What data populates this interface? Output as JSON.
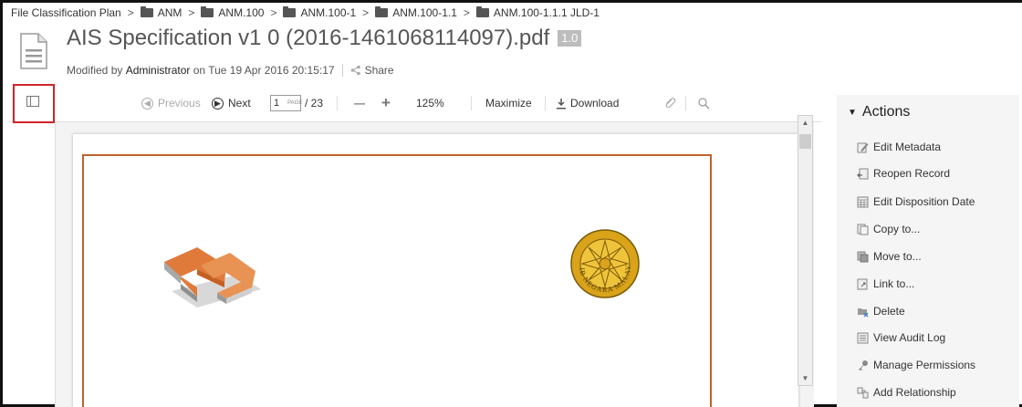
{
  "breadcrumb": [
    {
      "label": "File Classification Plan",
      "folder": false
    },
    {
      "label": "ANM",
      "folder": true
    },
    {
      "label": "ANM.100",
      "folder": true
    },
    {
      "label": "ANM.100-1",
      "folder": true
    },
    {
      "label": "ANM.100-1.1",
      "folder": true
    },
    {
      "label": "ANM.100-1.1.1 JLD-1",
      "folder": true
    }
  ],
  "breadcrumb_sep": ">",
  "document": {
    "title": "AIS Specification v1 0 (2016-1461068114097).pdf",
    "version": "1.0",
    "modified_prefix": "Modified by",
    "modified_user": "Administrator",
    "modified_on": "on Tue 19 Apr 2016 20:15:17",
    "share_label": "Share"
  },
  "toolbar": {
    "previous_label": "Previous",
    "next_label": "Next",
    "page_value": "1",
    "page_placeholder": "PAGE",
    "page_total": "/ 23",
    "zoom_out_label": "—",
    "zoom_in_label": "+",
    "zoom_level": "125%",
    "maximize_label": "Maximize",
    "download_label": "Download"
  },
  "actions": {
    "header": "Actions",
    "items": [
      {
        "label": "Edit Metadata",
        "icon": "edit-metadata-icon"
      },
      {
        "label": "Reopen Record",
        "icon": "reopen-record-icon"
      },
      {
        "label": "Edit Disposition Date",
        "icon": "calendar-icon"
      },
      {
        "label": "Copy to...",
        "icon": "copy-icon"
      },
      {
        "label": "Move to...",
        "icon": "move-icon"
      },
      {
        "label": "Link to...",
        "icon": "link-doc-icon"
      },
      {
        "label": "Delete",
        "icon": "delete-folder-icon"
      },
      {
        "label": "View Audit Log",
        "icon": "audit-log-icon"
      },
      {
        "label": "Manage Permissions",
        "icon": "key-icon"
      },
      {
        "label": "Add Relationship",
        "icon": "relationship-icon"
      }
    ]
  },
  "colors": {
    "page_border": "#c0612b",
    "highlight_box": "#d0232a",
    "logo_orange": "#e07a3a",
    "seal_gold": "#d9a31a"
  },
  "seal": {
    "text_top": "ارکيب نڬارا مليسيا",
    "text_bottom": "ARKIB NEGARA MALAYSIA"
  }
}
